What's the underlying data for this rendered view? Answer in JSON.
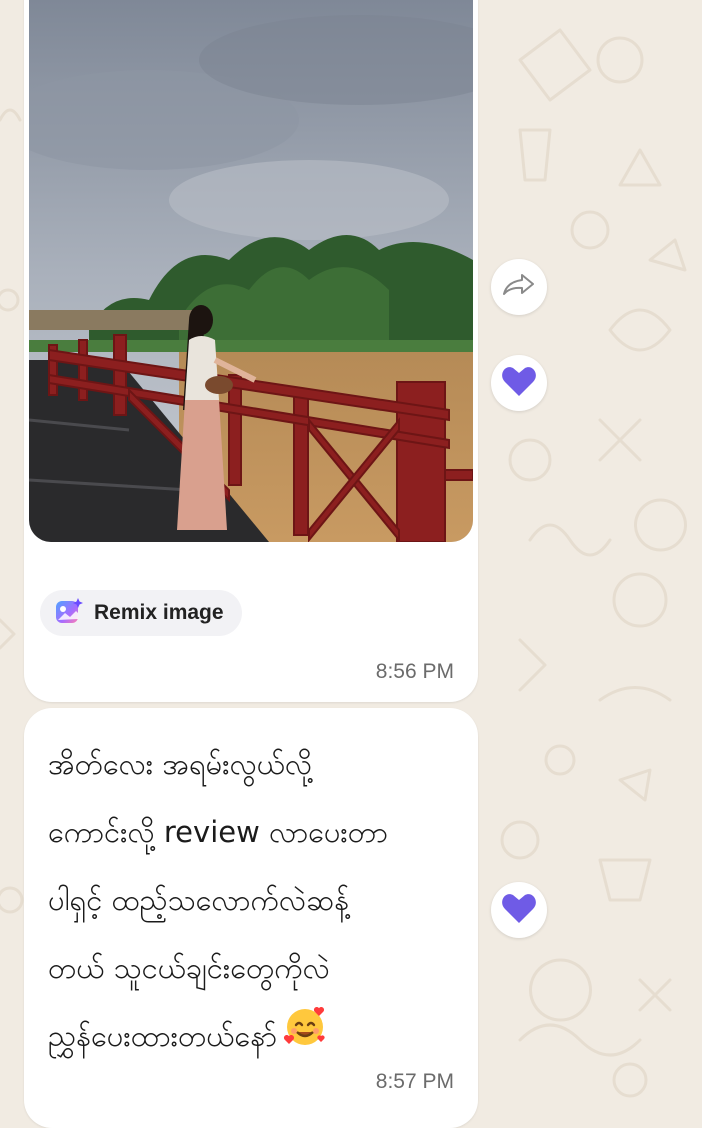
{
  "photo_message": {
    "remix_label": "Remix image",
    "time": "8:56 PM",
    "reaction_icon": "heart-icon"
  },
  "text_message": {
    "lines": [
      "အိတ်လေး အရမ်းလွယ်လို့",
      "ကောင်းလို့ review လာပေးတာ",
      "ပါရှင့် ထည့်သလောက်လဲဆန့်",
      "တယ် သူငယ်ချင်းတွေကိုလဲ",
      "ညွှန်ပေးထားတယ်နော်"
    ],
    "emoji": "smiling-face-with-hearts",
    "time": "8:57 PM",
    "reaction_icon": "heart-icon"
  },
  "actions": {
    "forward_icon": "forward-icon"
  },
  "colors": {
    "reaction": "#6f5be6",
    "background": "#f1ebe2",
    "bubble": "#ffffff"
  }
}
